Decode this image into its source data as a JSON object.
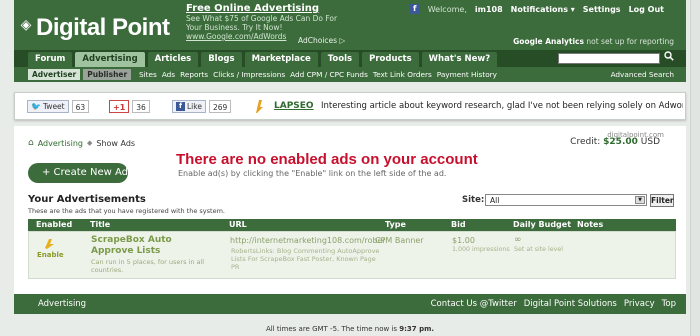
{
  "header": {
    "logo": "Digital Point",
    "ad": {
      "title": "Free Online Advertising",
      "line1": "See What $75 of Google Ads Can Do For",
      "line2": "Your Business. Try It Now!",
      "url": "www.Google.com/AdWords",
      "adchoices": "AdChoices ▷"
    },
    "user_bar": {
      "fb": "f",
      "welcome": "Welcome,",
      "username": "im108",
      "notifications": "Notifications ▾",
      "settings": "Settings",
      "logout": "Log Out"
    },
    "ga_note_bold": "Google Analytics",
    "ga_note_rest": "not set up for reporting"
  },
  "nav": {
    "tabs": [
      "Forum",
      "Advertising",
      "Articles",
      "Blogs",
      "Marketplace",
      "Tools",
      "Products",
      "What's New?"
    ],
    "active_index": 1
  },
  "subnav": {
    "advertiser": "Advertiser",
    "publisher": "Publisher",
    "links": [
      "Sites",
      "Ads",
      "Reports",
      "Clicks / Impressions",
      "Add CPM / CPC Funds",
      "Text Link Orders",
      "Payment History"
    ],
    "advanced_search": "Advanced Search"
  },
  "social": {
    "tweet": "Tweet",
    "tweet_count": "63",
    "gplus": "+1",
    "gplus_count": "36",
    "like": "Like",
    "like_count": "269",
    "lapseo": "LAPSEO",
    "lapseo_text": "Interesting article about keyword research, glad I've not been relying solely on Adword"
  },
  "breadcrumb": {
    "advertising": "Advertising",
    "show_ads": "Show Ads"
  },
  "account": {
    "site_note": "digitalpoint.com",
    "credit_label": "Credit:",
    "credit_value": "$25.00",
    "credit_currency": "USD"
  },
  "create_button": "+ Create New Ad",
  "notice": {
    "title": "There are no enabled ads on your account",
    "sub": "Enable ad(s) by clicking the \"Enable\" link on the left side of the ad."
  },
  "your_ads": {
    "title": "Your Advertisements",
    "sub": "These are the ads that you have registered with the system."
  },
  "filter": {
    "site_label": "Site:",
    "selected": "All",
    "button": "Filter"
  },
  "table": {
    "headers": [
      "Enabled",
      "Title",
      "URL",
      "Type",
      "Bid",
      "Daily Budget",
      "Notes"
    ],
    "row": {
      "enable": "Enable",
      "title": "ScrapeBox Auto Approve Lists",
      "title_sub": "Can run in 5 places, for users in all countries.",
      "url": "http://internetmarketing108.com/rober",
      "type": "CPM Banner",
      "desc": "RobertsLinks: Blog Commenting AutoApprove Lists For ScrapeBox Fast Poster, Known Page PR",
      "bid": "$1.00",
      "bid_sub": "1,000 impressions",
      "budget": "∞",
      "budget_sub": "Set at site level"
    }
  },
  "footer": {
    "left": "Advertising",
    "links": [
      "Contact Us @Twitter",
      "Digital Point Solutions",
      "Privacy",
      "Top"
    ]
  },
  "time_note_prefix": "All times are GMT -5. The time now is",
  "time_note_time": "9:37 pm."
}
